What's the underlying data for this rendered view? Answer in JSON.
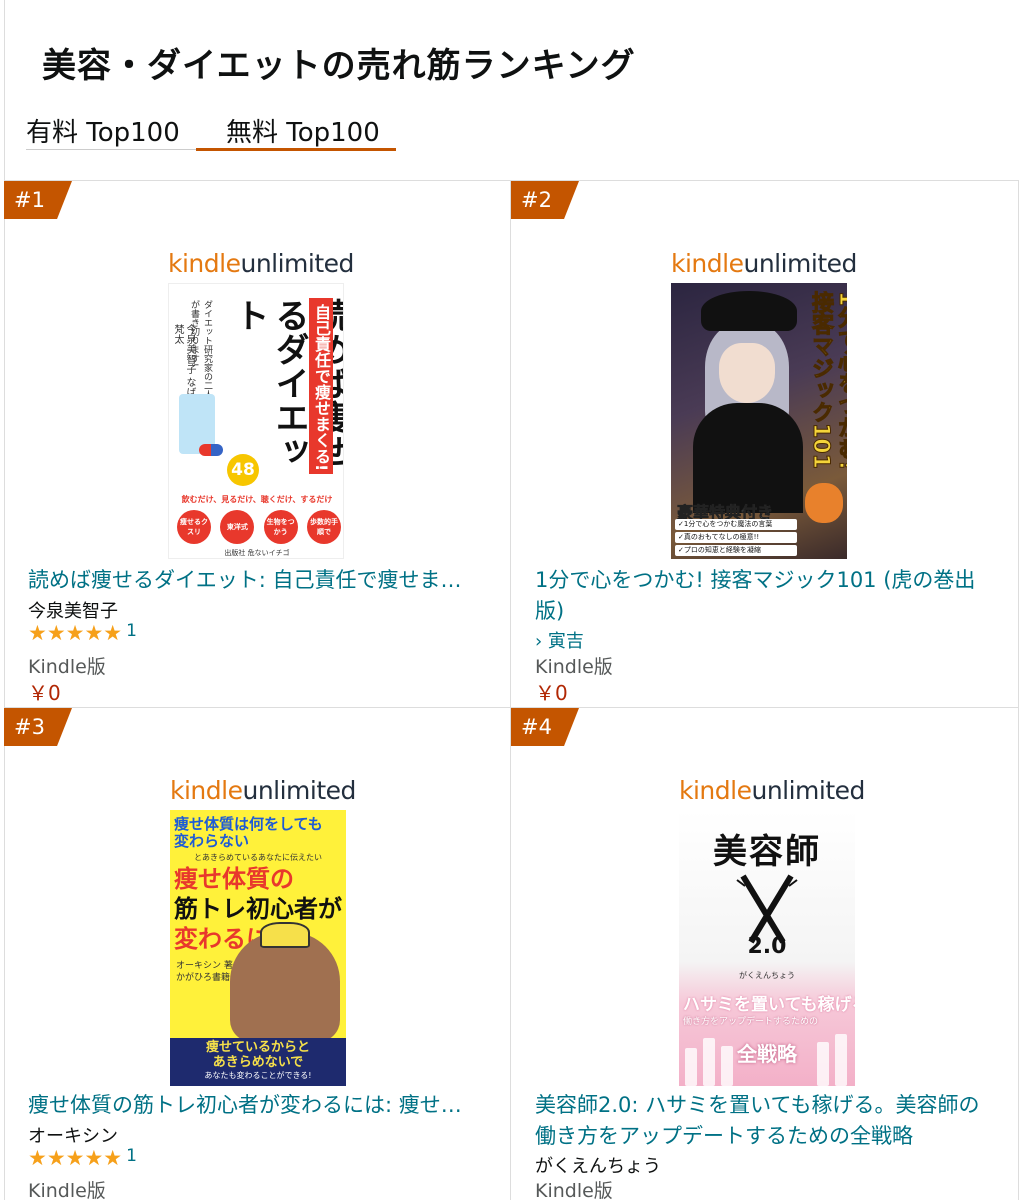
{
  "page": {
    "title": "美容・ダイエットの売れ筋ランキング",
    "tabs": [
      {
        "label": "有料 Top100",
        "active": false
      },
      {
        "label": "無料 Top100",
        "active": true
      }
    ]
  },
  "colors": {
    "accent": "#c45500",
    "link": "#007185",
    "price": "#b12704",
    "star": "#f6a01a"
  },
  "kindle_unlimited": {
    "kindle": "kindle",
    "unlimited": "unlimited"
  },
  "items": [
    {
      "rank": "#1",
      "title": "読めば痩せるダイエット: 自己責任で痩せま…",
      "author": "今泉美智子",
      "stars": "★★★★★",
      "rating_value": 5,
      "review_count": "1",
      "format": "Kindle版",
      "price": "￥0",
      "cover": {
        "band": "自己責任で痩せまくる!",
        "main": "読めば痩せるダイエット",
        "number": "48",
        "small": "ダイエット研究家の二人が書き切ります!",
        "authors": "今泉美智子 なば梵太",
        "subtitle": "飲むだけ、見るだけ、聴くだけ、するだけ",
        "circles": [
          "痩せるクスリ",
          "東洋式",
          "生物をつかう",
          "歩数的手順で"
        ],
        "publisher": "出版社 危ないイチゴ"
      }
    },
    {
      "rank": "#2",
      "title_line1": "1分で心をつかむ! 接客マジック101 (虎の巻出",
      "title_line2": "版)",
      "author": "› 寅吉",
      "format": "Kindle版",
      "price": "￥0",
      "cover": {
        "vertical_title": "1分で心をつかむ!接客マジック101",
        "bonus": "豪華特典付き",
        "list": [
          "✓1分で心をつかむ魔法の言葉",
          "✓真のおもてなしの極意!!",
          "✓プロの知恵と経験を凝縮"
        ]
      }
    },
    {
      "rank": "#3",
      "title": "痩せ体質の筋トレ初心者が変わるには: 痩せ…",
      "author": "オーキシン",
      "stars": "★★★★★",
      "rating_value": 5,
      "review_count": "1",
      "format": "Kindle版",
      "cover": {
        "line1": "痩せ体質は何をしても",
        "line2": "変わらない",
        "line3": "とあきらめているあなたに伝えたい",
        "main1": "痩せ体質の",
        "main2": "筋トレ初心者が",
        "main3": "変わるには",
        "author": "オーキシン 著",
        "publisher": "かがひろ書籍",
        "box1": "痩せているからと",
        "box2": "あきらめないで",
        "box3": "あなたも変わることができる!"
      }
    },
    {
      "rank": "#4",
      "title_line1": "美容師2.0: ハサミを置いても稼げる。美容師の",
      "title_line2": "働き方をアップデートするための全戦略",
      "author": "がくえんちょう",
      "format": "Kindle版",
      "cover": {
        "main": "美容師",
        "num": "2.0",
        "yomi": "がくえんちょう",
        "hook": "ハサミを置いても稼げる!",
        "sub": "働き方をアップデートするための",
        "big": "全戦略"
      }
    }
  ]
}
